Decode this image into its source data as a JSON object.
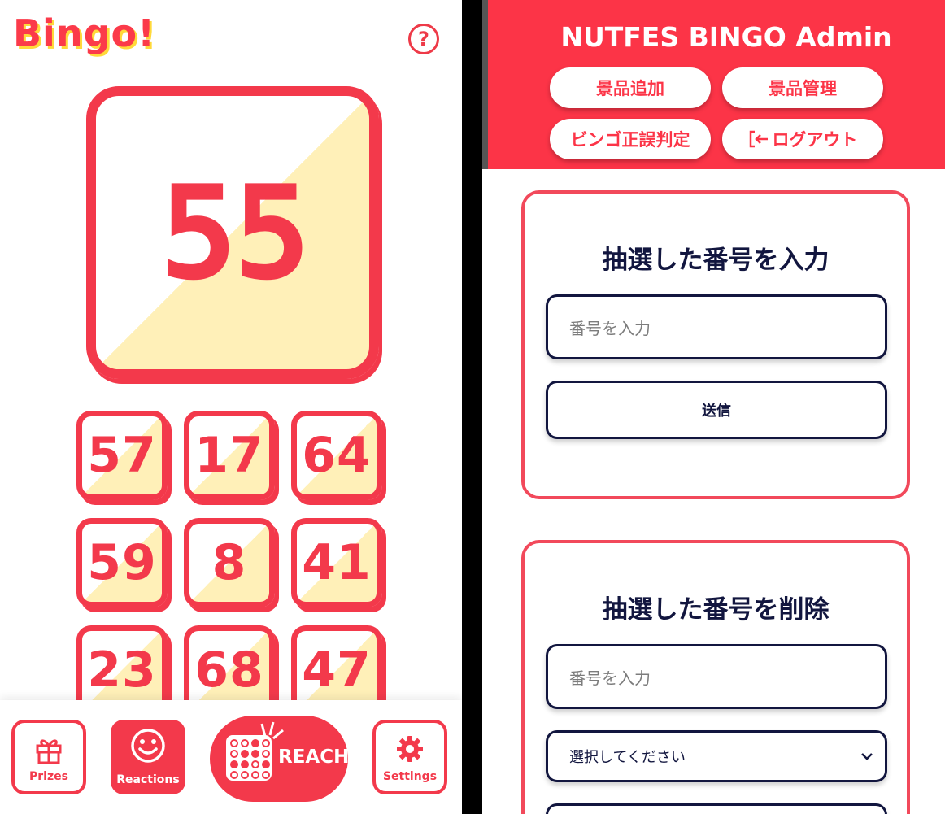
{
  "user_app": {
    "logo": "Bingo!",
    "help_icon": "?",
    "current_number": "55",
    "history_numbers": [
      "57",
      "17",
      "64",
      "59",
      "8",
      "41",
      "23",
      "68",
      "47"
    ],
    "nav": {
      "prizes_label": "Prizes",
      "reactions_label": "Reactions",
      "reach_label": "REACH",
      "settings_label": "Settings"
    }
  },
  "admin": {
    "title": "NUTFES BINGO Admin",
    "buttons": {
      "add_prize": "景品追加",
      "manage_prize": "景品管理",
      "check_bingo": "ビンゴ正誤判定",
      "logout": "ログアウト"
    },
    "input_section": {
      "title": "抽選した番号を入力",
      "placeholder": "番号を入力",
      "submit_label": "送信"
    },
    "delete_section": {
      "title": "抽選した番号を削除",
      "placeholder": "番号を入力",
      "select_value": "選択してください"
    }
  },
  "colors": {
    "accent": "#f3394b",
    "card_fill": "#fff0b8",
    "navy": "#12163f"
  }
}
